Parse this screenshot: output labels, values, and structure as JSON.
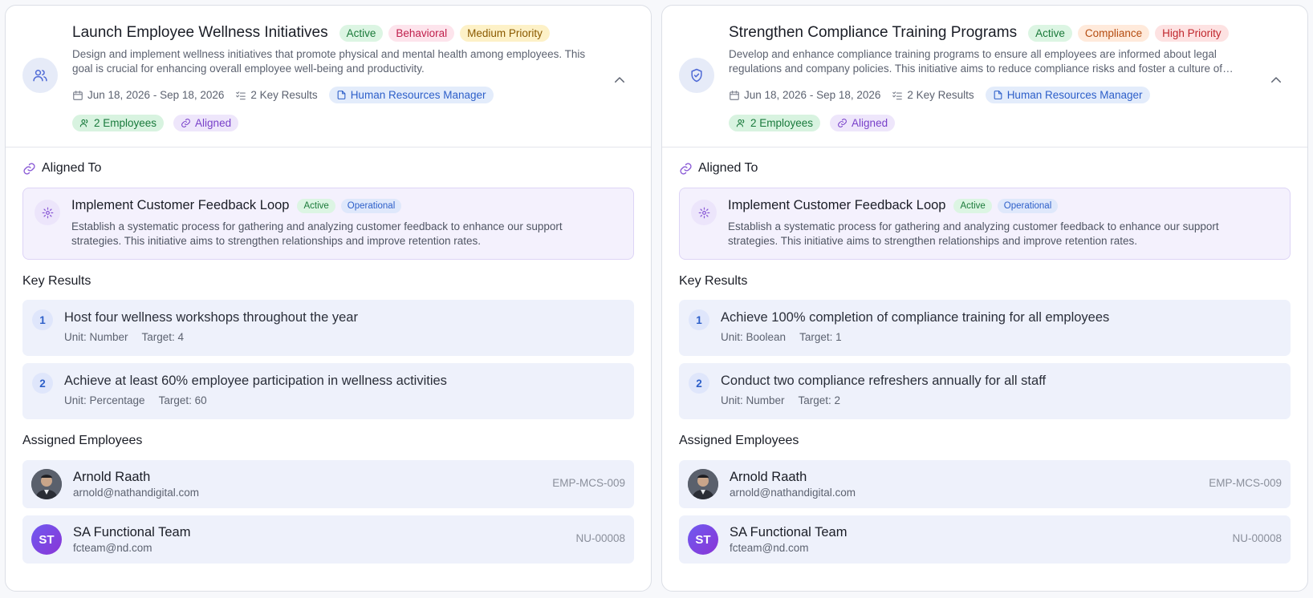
{
  "cards": [
    {
      "title": "Launch Employee Wellness Initiatives",
      "badges": [
        "Active",
        "Behavioral",
        "Medium Priority"
      ],
      "description": "Design and implement wellness initiatives that promote physical and mental health among employees. This goal is crucial for enhancing overall employee well-being and productivity.",
      "date_range": "Jun 18, 2026 - Sep 18, 2026",
      "key_results_count": "2 Key Results",
      "role": "Human Resources Manager",
      "employees_chip": "2 Employees",
      "aligned_chip": "Aligned",
      "goal_icon": "users-icon",
      "aligned_section_label": "Aligned To",
      "aligned": {
        "title": "Implement Customer Feedback Loop",
        "status": "Active",
        "type": "Operational",
        "description": "Establish a systematic process for gathering and analyzing customer feedback to enhance our support strategies. This initiative aims to strengthen relationships and improve retention rates."
      },
      "key_results_label": "Key Results",
      "key_results": [
        {
          "number": "1",
          "title": "Host four wellness workshops throughout the year",
          "unit": "Unit: Number",
          "target": "Target: 4"
        },
        {
          "number": "2",
          "title": "Achieve at least 60% employee participation in wellness activities",
          "unit": "Unit: Percentage",
          "target": "Target: 60"
        }
      ],
      "employees_label": "Assigned Employees",
      "employees": [
        {
          "name": "Arnold Raath",
          "email": "arnold@nathandigital.com",
          "id": "EMP-MCS-009",
          "initials": ""
        },
        {
          "name": "SA Functional Team",
          "email": "fcteam@nd.com",
          "id": "NU-00008",
          "initials": "ST"
        }
      ]
    },
    {
      "title": "Strengthen Compliance Training Programs",
      "badges": [
        "Active",
        "Compliance",
        "High Priority"
      ],
      "description": "Develop and enhance compliance training programs to ensure all employees are informed about legal regulations and company policies. This initiative aims to reduce compliance risks and foster a culture of compliance.",
      "date_range": "Jun 18, 2026 - Sep 18, 2026",
      "key_results_count": "2 Key Results",
      "role": "Human Resources Manager",
      "employees_chip": "2 Employees",
      "aligned_chip": "Aligned",
      "goal_icon": "shield-check-icon",
      "aligned_section_label": "Aligned To",
      "aligned": {
        "title": "Implement Customer Feedback Loop",
        "status": "Active",
        "type": "Operational",
        "description": "Establish a systematic process for gathering and analyzing customer feedback to enhance our support strategies. This initiative aims to strengthen relationships and improve retention rates."
      },
      "key_results_label": "Key Results",
      "key_results": [
        {
          "number": "1",
          "title": "Achieve 100% completion of compliance training for all employees",
          "unit": "Unit: Boolean",
          "target": "Target: 1"
        },
        {
          "number": "2",
          "title": "Conduct two compliance refreshers annually for all staff",
          "unit": "Unit: Number",
          "target": "Target: 2"
        }
      ],
      "employees_label": "Assigned Employees",
      "employees": [
        {
          "name": "Arnold Raath",
          "email": "arnold@nathandigital.com",
          "id": "EMP-MCS-009",
          "initials": ""
        },
        {
          "name": "SA Functional Team",
          "email": "fcteam@nd.com",
          "id": "NU-00008",
          "initials": "ST"
        }
      ]
    }
  ]
}
